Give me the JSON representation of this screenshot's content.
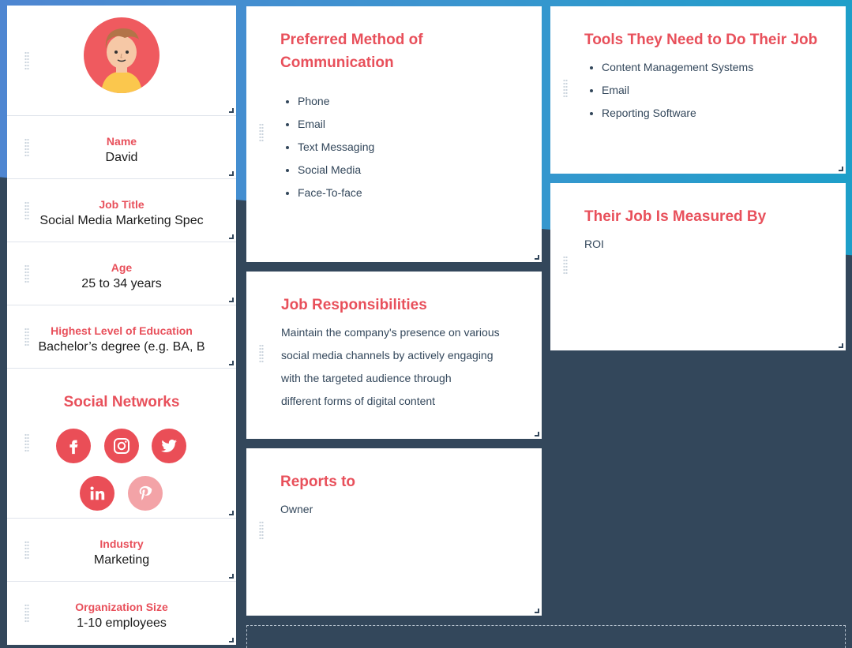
{
  "profile": {
    "name_label": "Name",
    "name_value": "David",
    "job_title_label": "Job Title",
    "job_title_value": "Social Media Marketing Spec",
    "age_label": "Age",
    "age_value": "25 to 34 years",
    "education_label": "Highest Level of Education",
    "education_value": "Bachelor’s degree (e.g. BA, B",
    "social_title": "Social Networks",
    "social_icons": [
      "facebook-icon",
      "instagram-icon",
      "twitter-icon",
      "linkedin-icon",
      "pinterest-icon"
    ],
    "industry_label": "Industry",
    "industry_value": "Marketing",
    "org_size_label": "Organization Size",
    "org_size_value": "1-10 employees"
  },
  "communication": {
    "title": "Preferred Method of Communication",
    "items": [
      "Phone",
      "Email",
      "Text Messaging",
      "Social Media",
      "Face-To-face"
    ]
  },
  "tools": {
    "title": "Tools They Need to Do Their Job",
    "items": [
      "Content Management Systems",
      "Email",
      "Reporting Software"
    ]
  },
  "measured": {
    "title": "Their Job Is Measured By",
    "value": "ROI"
  },
  "responsibilities": {
    "title": "Job Responsibilities",
    "lines": [
      "Maintain the company's presence on various",
      "social media channels by actively engaging",
      "with the targeted audience through",
      "different forms of digital content"
    ]
  },
  "reports": {
    "title": "Reports to",
    "value": "Owner"
  },
  "colors": {
    "accent": "#e8505b",
    "background": "#33475b",
    "gradient_start": "#4f86d1",
    "gradient_end": "#1e9fc9"
  }
}
